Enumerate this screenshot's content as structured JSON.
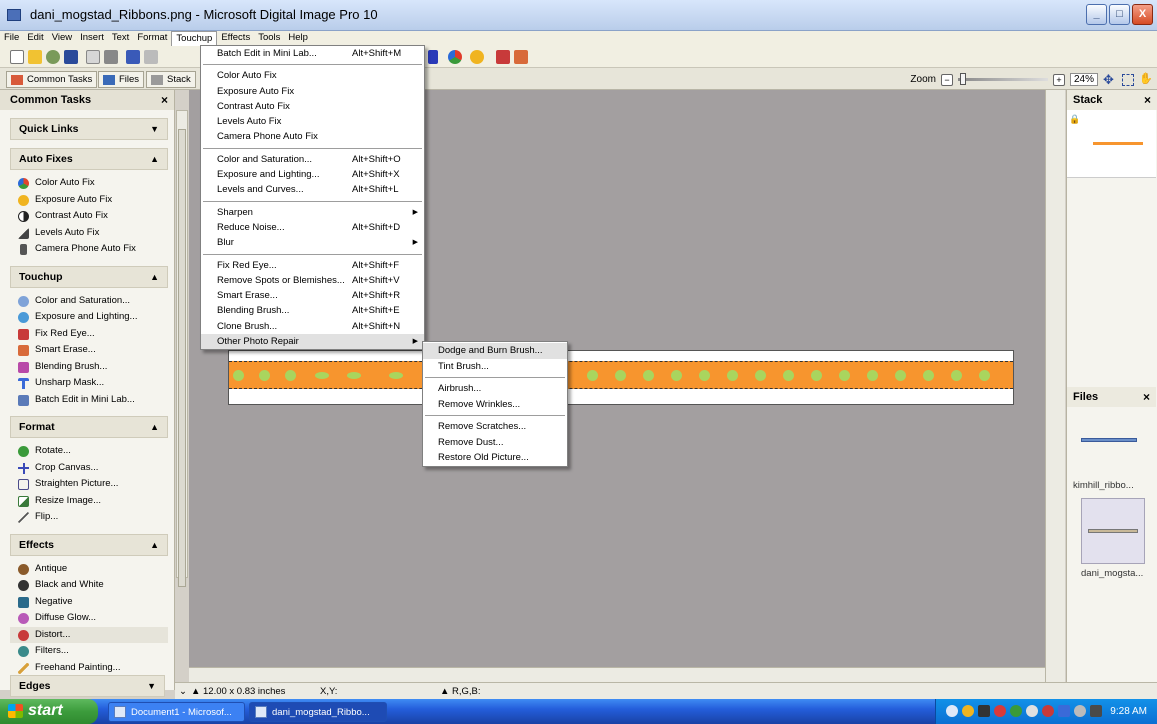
{
  "window": {
    "title": "dani_mogstad_Ribbons.png - Microsoft Digital Image Pro 10",
    "buttons": {
      "minimize": "_",
      "maximize": "□",
      "close": "X"
    }
  },
  "menubar": {
    "items": [
      "File",
      "Edit",
      "View",
      "Insert",
      "Text",
      "Format",
      "Touchup",
      "Effects",
      "Tools",
      "Help"
    ]
  },
  "tabs": {
    "common_tasks": "Common Tasks",
    "files": "Files",
    "stack": "Stack"
  },
  "zoom": {
    "label": "Zoom",
    "minus": "−",
    "plus": "+",
    "value": "24%",
    "level_percent": 24
  },
  "left_panel": {
    "header": "Common Tasks",
    "close": "×",
    "sections": [
      {
        "title": "Quick Links",
        "expanded": false,
        "items": []
      },
      {
        "title": "Auto Fixes",
        "expanded": true,
        "items": [
          {
            "label": "Color Auto Fix",
            "icon": "color-wheel-icon",
            "color": "#e0452c"
          },
          {
            "label": "Exposure Auto Fix",
            "icon": "sun-icon",
            "color": "#f0b420"
          },
          {
            "label": "Contrast Auto Fix",
            "icon": "contrast-icon",
            "color": "#222222"
          },
          {
            "label": "Levels Auto Fix",
            "icon": "levels-icon",
            "color": "#444444"
          },
          {
            "label": "Camera Phone Auto Fix",
            "icon": "phone-icon",
            "color": "#555555"
          }
        ]
      },
      {
        "title": "Touchup",
        "expanded": true,
        "items": [
          {
            "label": "Color and Saturation...",
            "icon": "color-wheel-icon",
            "color": "#7fa3d8"
          },
          {
            "label": "Exposure and Lighting...",
            "icon": "exposure-icon",
            "color": "#4a9ad8"
          },
          {
            "label": "Fix Red Eye...",
            "icon": "red-eye-icon",
            "color": "#c83a3a"
          },
          {
            "label": "Smart Erase...",
            "icon": "eraser-icon",
            "color": "#d86a3a"
          },
          {
            "label": "Blending Brush...",
            "icon": "brush-icon",
            "color": "#b84aa8"
          },
          {
            "label": "Unsharp Mask...",
            "icon": "funnel-icon",
            "color": "#3a6ad8"
          },
          {
            "label": "Batch Edit in Mini Lab...",
            "icon": "batch-icon",
            "color": "#5a7ab8"
          }
        ]
      },
      {
        "title": "Format",
        "expanded": true,
        "items": [
          {
            "label": "Rotate...",
            "icon": "rotate-icon",
            "color": "#3a9a3a"
          },
          {
            "label": "Crop Canvas...",
            "icon": "crop-icon",
            "color": "#3a4ab8"
          },
          {
            "label": "Straighten Picture...",
            "icon": "straighten-icon",
            "color": "#4a4a8a"
          },
          {
            "label": "Resize Image...",
            "icon": "resize-icon",
            "color": "#3a7a3a"
          },
          {
            "label": "Flip...",
            "icon": "flip-icon",
            "color": "#555555"
          }
        ]
      },
      {
        "title": "Effects",
        "expanded": true,
        "items": [
          {
            "label": "Antique",
            "icon": "antique-icon",
            "color": "#8a5a2a"
          },
          {
            "label": "Black and White",
            "icon": "bw-icon",
            "color": "#333333"
          },
          {
            "label": "Negative",
            "icon": "negative-icon",
            "color": "#2a6a8a"
          },
          {
            "label": "Diffuse Glow...",
            "icon": "glow-icon",
            "color": "#b85ab8"
          },
          {
            "label": "Distort...",
            "icon": "distort-icon",
            "color": "#c83a3a"
          },
          {
            "label": "Filters...",
            "icon": "filters-icon",
            "color": "#3a8a8a"
          },
          {
            "label": "Freehand Painting...",
            "icon": "paint-icon",
            "color": "#d8a03a"
          }
        ]
      }
    ],
    "edges_section": "Edges"
  },
  "touchup_menu": {
    "groups": [
      [
        {
          "label": "Batch Edit in Mini Lab...",
          "shortcut": "Alt+Shift+M"
        }
      ],
      [
        {
          "label": "Color Auto Fix",
          "shortcut": ""
        },
        {
          "label": "Exposure Auto Fix",
          "shortcut": ""
        },
        {
          "label": "Contrast Auto Fix",
          "shortcut": ""
        },
        {
          "label": "Levels Auto Fix",
          "shortcut": ""
        },
        {
          "label": "Camera Phone Auto Fix",
          "shortcut": ""
        }
      ],
      [
        {
          "label": "Color and Saturation...",
          "shortcut": "Alt+Shift+O"
        },
        {
          "label": "Exposure and Lighting...",
          "shortcut": "Alt+Shift+X"
        },
        {
          "label": "Levels and Curves...",
          "shortcut": "Alt+Shift+L"
        }
      ],
      [
        {
          "label": "Sharpen",
          "shortcut": "",
          "submenu": true
        },
        {
          "label": "Reduce Noise...",
          "shortcut": "Alt+Shift+D"
        },
        {
          "label": "Blur",
          "shortcut": "",
          "submenu": true
        }
      ],
      [
        {
          "label": "Fix Red Eye...",
          "shortcut": "Alt+Shift+F"
        },
        {
          "label": "Remove Spots or Blemishes...",
          "shortcut": "Alt+Shift+V"
        },
        {
          "label": "Smart Erase...",
          "shortcut": "Alt+Shift+R"
        },
        {
          "label": "Blending Brush...",
          "shortcut": "Alt+Shift+E"
        },
        {
          "label": "Clone Brush...",
          "shortcut": "Alt+Shift+N"
        },
        {
          "label": "Other Photo Repair",
          "shortcut": "",
          "submenu": true,
          "highlighted": true
        }
      ]
    ]
  },
  "photo_repair_submenu": {
    "groups": [
      [
        "Dodge and Burn Brush...",
        "Tint Brush..."
      ],
      [
        "Airbrush...",
        "Remove Wrinkles..."
      ],
      [
        "Remove Scratches...",
        "Remove Dust...",
        "Restore Old Picture..."
      ]
    ]
  },
  "right_panel": {
    "stack_title": "Stack",
    "files_title": "Files",
    "close": "×",
    "files": [
      {
        "name": "kimhill_ribbo...",
        "selected": false
      },
      {
        "name": "dani_mogsta...",
        "selected": true
      }
    ]
  },
  "statusbar": {
    "size": "12.00 x 0.83 inches",
    "xy": "X,Y:",
    "rgb": "R,G,B:"
  },
  "taskbar": {
    "start": "start",
    "tasks": [
      {
        "label": "Document1 - Microsof...",
        "active": false
      },
      {
        "label": "dani_mogstad_Ribbo...",
        "active": true
      }
    ],
    "clock": "9:28 AM"
  },
  "colors": {
    "ribbon_orange": "#f7952e",
    "ribbon_dot_green": "#a9d55e",
    "canvas_bg": "#a39fa0"
  }
}
